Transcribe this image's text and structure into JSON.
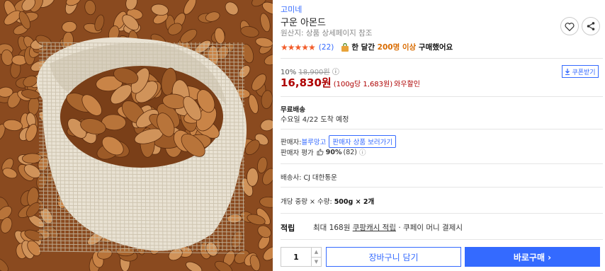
{
  "product": {
    "brand": "고미네",
    "title": "구운 아몬드",
    "origin": "원산지: 상품 상세페이지 참조",
    "image_alt": "almonds in a burlap sack"
  },
  "rating": {
    "stars": 4.5,
    "stars_display": "★★★★★",
    "review_count": "(22)",
    "monthly_buyers_prefix": "한 달간 ",
    "monthly_buyers_count": "200명 이상",
    "monthly_buyers_suffix": " 구매했어요"
  },
  "price": {
    "discount_rate": "10%",
    "original_price": "18,900원",
    "info_icon": "ⓘ",
    "sale_price": "16,830원",
    "unit_price": "(100g당 1,683원)",
    "promo": "와우할인",
    "coupon_label": "쿠폰받기"
  },
  "shipping": {
    "label": "무료배송",
    "arrival": "수요일 4/22 도착 예정"
  },
  "seller": {
    "prefix": "판매자: ",
    "name": "블루망고",
    "view_products": "판매자 상품 보러가기",
    "rating_label": "판매자 평가",
    "rating_percent": "90%",
    "rating_count": "(82)"
  },
  "carrier": "배송사: CJ 대한통운",
  "option": {
    "label": "개당 중량 × 수량: ",
    "value": "500g × 2개"
  },
  "points": {
    "label": "적립",
    "prefix": "최대 168원 ",
    "link": "쿠팡캐시 적립",
    "suffix": " · 쿠페이 머니 결제시"
  },
  "actions": {
    "quantity": "1",
    "cart": "장바구니 담기",
    "buy": "바로구매 ›"
  },
  "colors": {
    "accent": "#346aff",
    "price": "#ae0000",
    "star": "#f25c2a"
  },
  "icons": [
    "heart-icon",
    "share-icon",
    "shopping-bag-icon",
    "thumbs-up-icon",
    "download-icon",
    "info-icon"
  ]
}
